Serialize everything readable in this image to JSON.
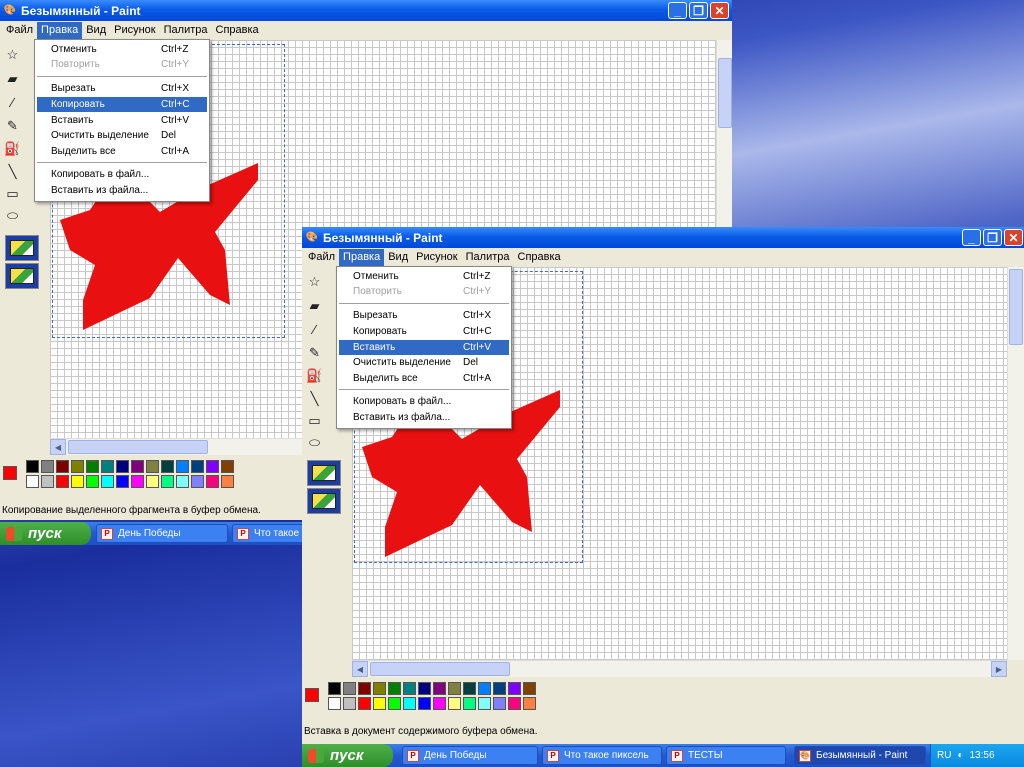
{
  "colors": {
    "star": "#e81010",
    "title_bar": "#0a5ce6",
    "highlight": "#316ac5"
  },
  "window1": {
    "title": "Безымянный - Paint",
    "menu": [
      "Файл",
      "Правка",
      "Вид",
      "Рисунок",
      "Палитра",
      "Справка"
    ],
    "edit_menu": {
      "items": [
        {
          "label": "Отменить",
          "key": "Ctrl+Z"
        },
        {
          "label": "Повторить",
          "key": "Ctrl+Y"
        },
        {
          "label": "Вырезать",
          "key": "Ctrl+X"
        },
        {
          "label": "Копировать",
          "key": "Ctrl+C"
        },
        {
          "label": "Вставить",
          "key": "Ctrl+V"
        },
        {
          "label": "Очистить выделение",
          "key": "Del"
        },
        {
          "label": "Выделить все",
          "key": "Ctrl+A"
        },
        {
          "label": "Копировать в файл..."
        },
        {
          "label": "Вставить из файла..."
        }
      ],
      "highlighted": "Копировать",
      "disabled": [
        "Повторить"
      ]
    },
    "status": "Копирование выделенного фрагмента в буфер обмена."
  },
  "window2": {
    "title": "Безымянный - Paint",
    "menu": [
      "Файл",
      "Правка",
      "Вид",
      "Рисунок",
      "Палитра",
      "Справка"
    ],
    "edit_menu": {
      "items": [
        {
          "label": "Отменить",
          "key": "Ctrl+Z"
        },
        {
          "label": "Повторить",
          "key": "Ctrl+Y"
        },
        {
          "label": "Вырезать",
          "key": "Ctrl+X"
        },
        {
          "label": "Копировать",
          "key": "Ctrl+C"
        },
        {
          "label": "Вставить",
          "key": "Ctrl+V"
        },
        {
          "label": "Очистить выделение",
          "key": "Del"
        },
        {
          "label": "Выделить все",
          "key": "Ctrl+A"
        },
        {
          "label": "Копировать в файл..."
        },
        {
          "label": "Вставить из файла..."
        }
      ],
      "highlighted": "Вставить",
      "disabled": [
        "Повторить"
      ]
    },
    "status": "Вставка в документ содержимого буфера обмена."
  },
  "palette": {
    "top": [
      "#000000",
      "#808080",
      "#800000",
      "#808000",
      "#008000",
      "#008080",
      "#000080",
      "#800080",
      "#808040",
      "#004040",
      "#0080ff",
      "#004080",
      "#8000ff",
      "#804000"
    ],
    "bottom": [
      "#ffffff",
      "#c0c0c0",
      "#ff0000",
      "#ffff00",
      "#00ff00",
      "#00ffff",
      "#0000ff",
      "#ff00ff",
      "#ffff80",
      "#00ff80",
      "#80ffff",
      "#8080ff",
      "#ff0080",
      "#ff8040"
    ],
    "foreground": "#ff0000",
    "background": "#ffffff"
  },
  "taskbar1": {
    "start": "пуск",
    "items": [
      "День Победы",
      "Что такое"
    ]
  },
  "taskbar2": {
    "start": "пуск",
    "items": [
      "День Победы",
      "Что такое пиксель",
      "ТЕСТЫ",
      "Безымянный - Paint"
    ],
    "lang": "RU",
    "time": "13:56"
  },
  "icons": [
    "paint-icon",
    "minimize-icon",
    "maximize-icon",
    "close-icon",
    "select-icon",
    "eraser-icon",
    "picker-icon",
    "pencil-icon",
    "fill-icon",
    "line-icon",
    "rect-icon",
    "ellipse-icon",
    "windows-flag-icon",
    "ppt-icon"
  ]
}
